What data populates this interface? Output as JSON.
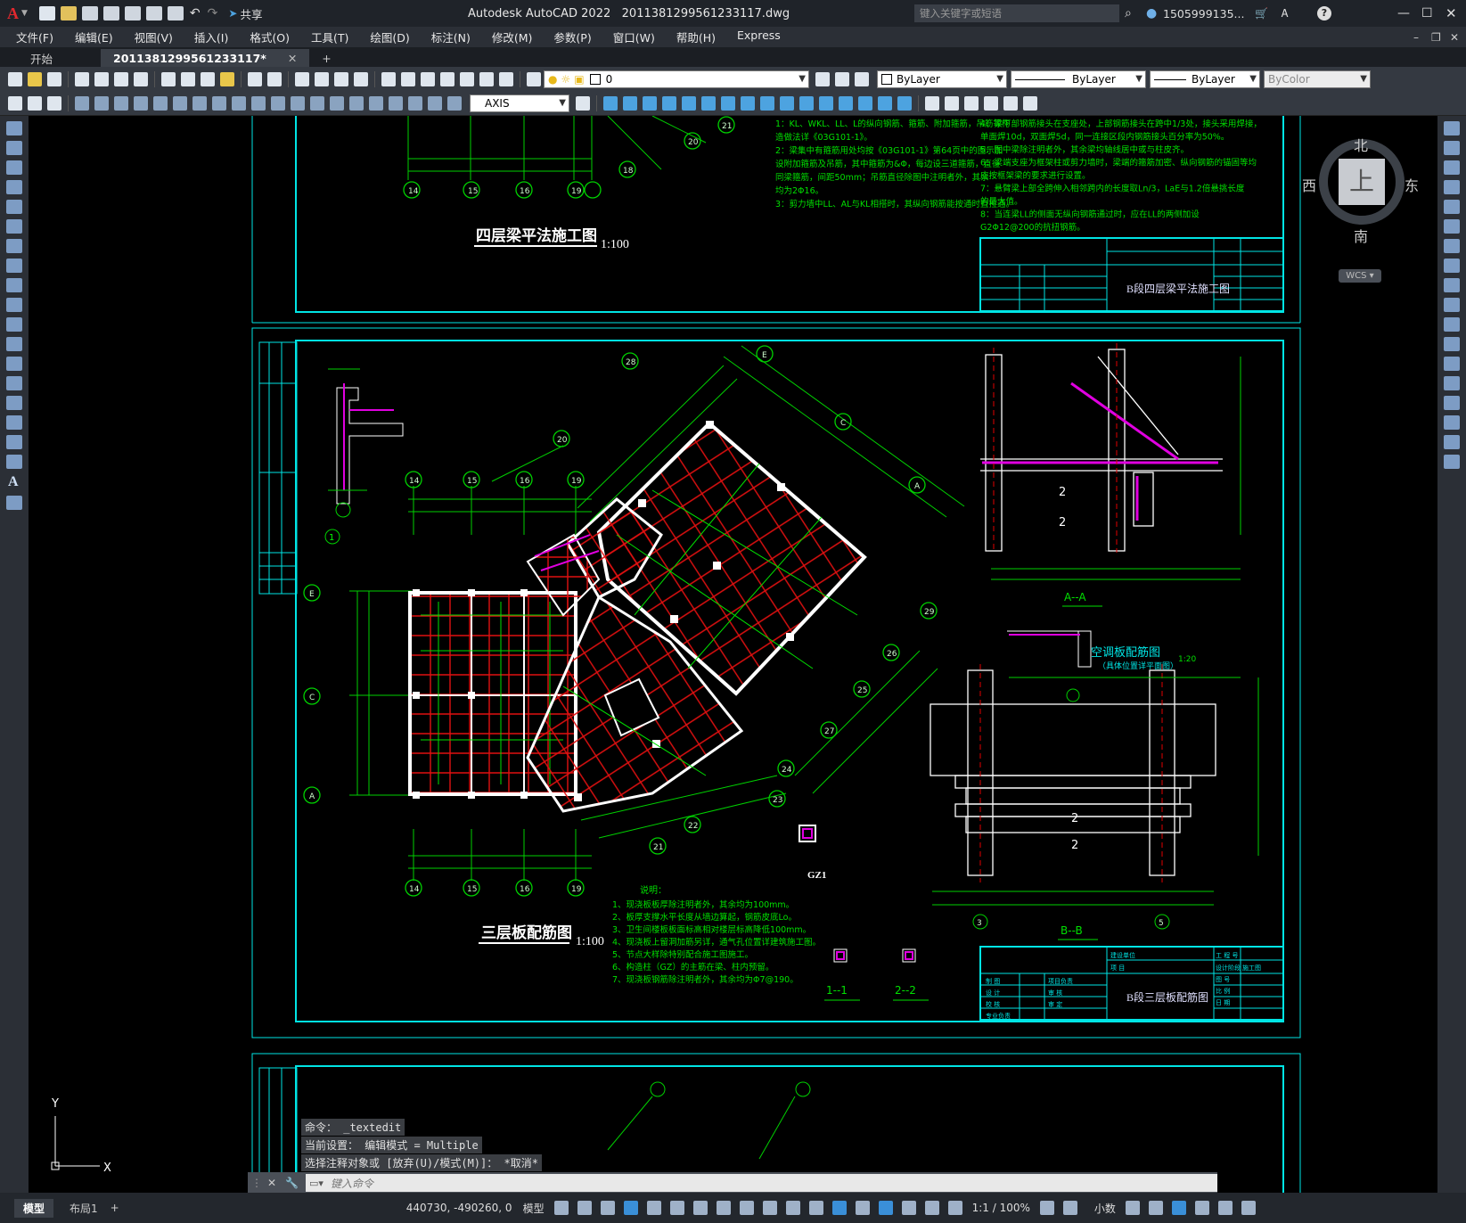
{
  "app": {
    "logo": "A",
    "title": "Autodesk AutoCAD 2022",
    "filename": "2011381299561233117.dwg",
    "share_label": "共享",
    "search_placeholder": "键入关键字或短语",
    "user": "1505999135...",
    "help": "?"
  },
  "menu": [
    "文件(F)",
    "编辑(E)",
    "视图(V)",
    "插入(I)",
    "格式(O)",
    "工具(T)",
    "绘图(D)",
    "标注(N)",
    "修改(M)",
    "参数(P)",
    "窗口(W)",
    "帮助(H)",
    "Express"
  ],
  "tabs": {
    "start": "开始",
    "doc": "2011381299561233117*",
    "add": "+"
  },
  "toolbar": {
    "layer_value": "0",
    "color_value": "ByLayer",
    "linetype_value": "ByLayer",
    "lineweight_value": "ByLayer",
    "plotstyle_value": "ByColor",
    "textstyle_value": "AXIS"
  },
  "viewcube": {
    "north": "北",
    "south": "南",
    "east": "东",
    "west": "西",
    "top": "上",
    "wcs": "WCS"
  },
  "ucs": {
    "x": "X",
    "y": "Y"
  },
  "drawing": {
    "top_title": "四层梁平法施工图",
    "top_scale": "1:100",
    "top_tb_name": "B段四层梁平法施工图",
    "top_notes": [
      "1：KL、WKL、LL、L的纵向钢筋、箍筋、附加箍筋，吊筋等构",
      "造做法详《03G101-1》。",
      "2：梁集中有箍筋用处均按《03G101-1》第64页中的图示加",
      "设附加箍筋及吊筋，其中箍筋为&Φ，每边设三道箍筋，直径",
      "同梁箍筋，间距50mm；吊筋直径除图中注明者外，其余",
      "均为2Φ16。",
      "3：剪力墙中LL、AL与KL相搭时，其纵向钢筋能按通时直拉通。"
    ],
    "top_notes_right": [
      "4：梁下部钢筋接头在支座处，上部钢筋接头在跨中1/3处，接头采用焊接，",
      "单面焊10d，双面焊5d，同一连接区段内钢筋接头百分率为50%。",
      "5：图中梁除注明者外，其余梁均轴线居中或与柱皮齐。",
      "6：梁端支座为框架柱或剪力墙时，梁端的箍筋加密、纵向钢筋的锚固等均",
      "应按框架梁的要求进行设置。",
      "7：悬臂梁上部全跨伸入相邻跨内的长度取Ln/3，LaE与1.2倍悬挑长度",
      "的最大值。",
      "8：当连梁LL的侧面无纵向钢筋通过时，应在LL的两侧加设",
      "G2Φ12@200的抗扭钢筋。"
    ],
    "main_title": "三层板配筋图",
    "main_scale": "1:100",
    "main_tb_name": "B段三层板配筋图",
    "ac_title": "空调板配筋图",
    "ac_scale": "1:20",
    "ac_sub": "（具体位置详平面图）",
    "section_aa": "A--A",
    "section_bb": "B--B",
    "section_1": "1--1",
    "section_2": "2--2",
    "gz1": "GZ1",
    "detail_1": "1",
    "notes_title": "说明：",
    "notes": [
      "1、现浇板板厚除注明者外，其余均为100mm。",
      "2、板厚支撑水平长度从墙边算起，钢筋皮底Lo。",
      "3、卫生间楼板板面标高相对楼层标高降低100mm。",
      "4、现浇板上留洞加筋另详，通气孔位置详建筑施工图。",
      "5、节点大样除特别配合施工图施工。",
      "6、构造柱（GZ）的主筋在梁、柱内预留。",
      "7、现浇板钢筋除注明者外，其余均为Φ7@190。"
    ],
    "axes_top": [
      "14",
      "15",
      "16",
      "19"
    ],
    "axes_left": [
      "E",
      "C",
      "A"
    ],
    "axes_rot": [
      "20",
      "21",
      "22",
      "23",
      "24",
      "25",
      "26",
      "27",
      "28",
      "29"
    ],
    "axes_rot2": [
      "A",
      "C",
      "E"
    ],
    "tb_labels": [
      "建设单位",
      "项 目",
      "工 程 号",
      "设计阶段",
      "施工图",
      "图 号",
      "比 例",
      "日 期",
      "制 图",
      "设 计",
      "校 核",
      "项目负责",
      "审 核",
      "审 定",
      "专业负责"
    ]
  },
  "command": {
    "line1": "命令： _textedit",
    "line2": "当前设置： 编辑模式 = Multiple",
    "line3": "选择注释对象或 [放弃(U)/模式(M)]： *取消*",
    "placeholder": "键入命令"
  },
  "status": {
    "layout_model": "模型",
    "layout_1": "布局1",
    "add": "+",
    "coords": "440730, -490260, 0",
    "space": "模型",
    "scale": "1:1 / 100%",
    "units": "小数"
  }
}
